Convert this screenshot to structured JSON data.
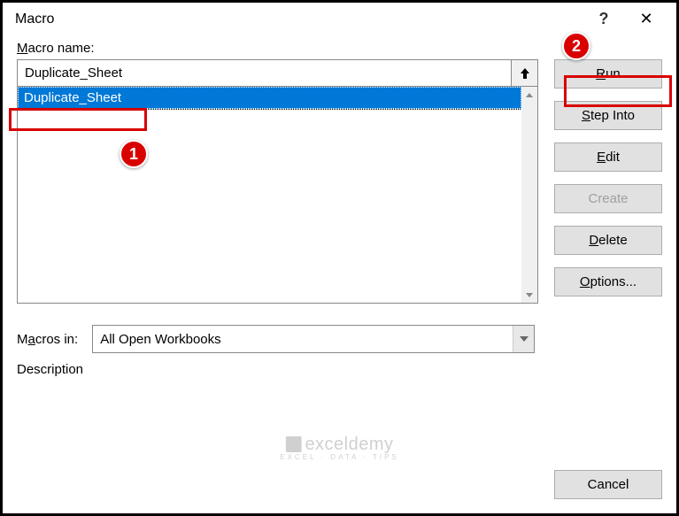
{
  "titlebar": {
    "title": "Macro",
    "help": "?",
    "close": "✕"
  },
  "labels": {
    "macro_name": "Macro name:",
    "macros_in": "Macros in:",
    "description": "Description"
  },
  "macro_name_input": "Duplicate_Sheet",
  "macro_list": {
    "items": [
      "Duplicate_Sheet"
    ],
    "selected_index": 0
  },
  "buttons": {
    "run": "Run",
    "step_into": "Step Into",
    "edit": "Edit",
    "create": "Create",
    "delete": "Delete",
    "options": "Options...",
    "cancel": "Cancel"
  },
  "macros_in_value": "All Open Workbooks",
  "annotations": {
    "badge1": "1",
    "badge2": "2"
  },
  "watermark": {
    "brand": "exceldemy",
    "tagline": "EXCEL · DATA · TIPS"
  }
}
